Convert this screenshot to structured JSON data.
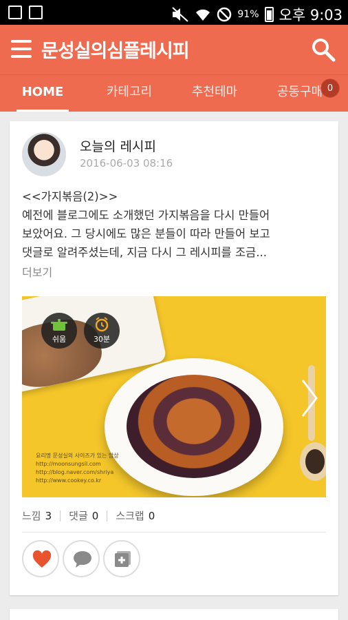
{
  "status_bar": {
    "battery": "91%",
    "time": "오후 9:03"
  },
  "app_bar": {
    "title": "문성실의심플레시피"
  },
  "tabs": [
    {
      "label": "HOME"
    },
    {
      "label": "카테고리"
    },
    {
      "label": "추천테마"
    },
    {
      "label": "공동구매"
    }
  ],
  "tab_badge": "0",
  "post": {
    "title": "오늘의 레시피",
    "date": "2016-06-03 08:16",
    "body_line1": "<<가지볶음(2)>>",
    "body_line2": "예전에 블로그에도 소개했던 가지볶음을 다시 만들어",
    "body_line3": "보았어요. 그 당시에도 많은 분들이 따라 만들어 보고",
    "body_line4": "댓글로 알려주셨는데, 지금 다시 그 레시피를 조금...",
    "more": "더보기",
    "photo_badges": {
      "difficulty": "쉬움",
      "time": "30분"
    },
    "photo_caption": [
      "요리명 문성실의 사이즈가 있는 밥상",
      "http://moonsungsil.com",
      "http://blog.naver.com/shriya",
      "http://www.cookey.co.kr"
    ],
    "stats": {
      "likes_label": "느낌",
      "likes": "3",
      "comments_label": "댓글",
      "comments": "0",
      "scraps_label": "스크랩",
      "scraps": "0"
    }
  },
  "colors": {
    "brand": "#ee6b50",
    "heart": "#e9542f"
  }
}
